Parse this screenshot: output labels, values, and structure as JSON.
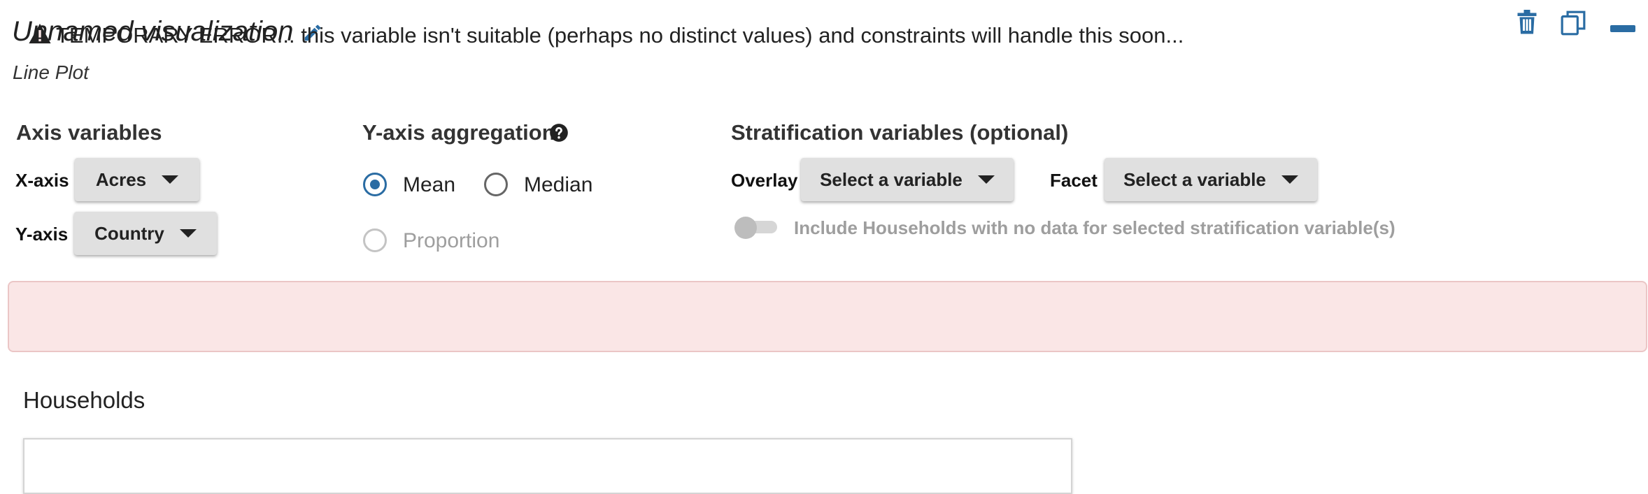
{
  "header": {
    "title": "Unnamed visualization",
    "subtitle": "Line Plot",
    "actions": {
      "delete": "trash-icon",
      "copy": "copy-icon",
      "minimize": "minimize-icon"
    }
  },
  "axis_variables": {
    "heading": "Axis variables",
    "x_label": "X-axis",
    "x_value": "Acres",
    "y_label": "Y-axis",
    "y_value": "Country"
  },
  "aggregation": {
    "heading": "Y-axis aggregation",
    "options": [
      "Mean",
      "Median",
      "Proportion"
    ],
    "selected": "Mean",
    "disabled": [
      "Proportion"
    ]
  },
  "stratification": {
    "heading": "Stratification variables (optional)",
    "overlay_label": "Overlay",
    "overlay_value": "Select a variable",
    "facet_label": "Facet",
    "facet_value": "Select a variable",
    "toggle_label": "Include Households with no data for selected stratification variable(s)",
    "toggle_on": false
  },
  "alert": {
    "text": "TEMPORARY ERROR... this variable isn't suitable (perhaps no distinct values) and constraints will handle this soon..."
  },
  "plot": {
    "title": "Households"
  },
  "colors": {
    "accent": "#2a6ca3",
    "alert_bg": "#fae6e6",
    "alert_border": "#ebc6c6",
    "button_bg": "#e0e0e0"
  }
}
